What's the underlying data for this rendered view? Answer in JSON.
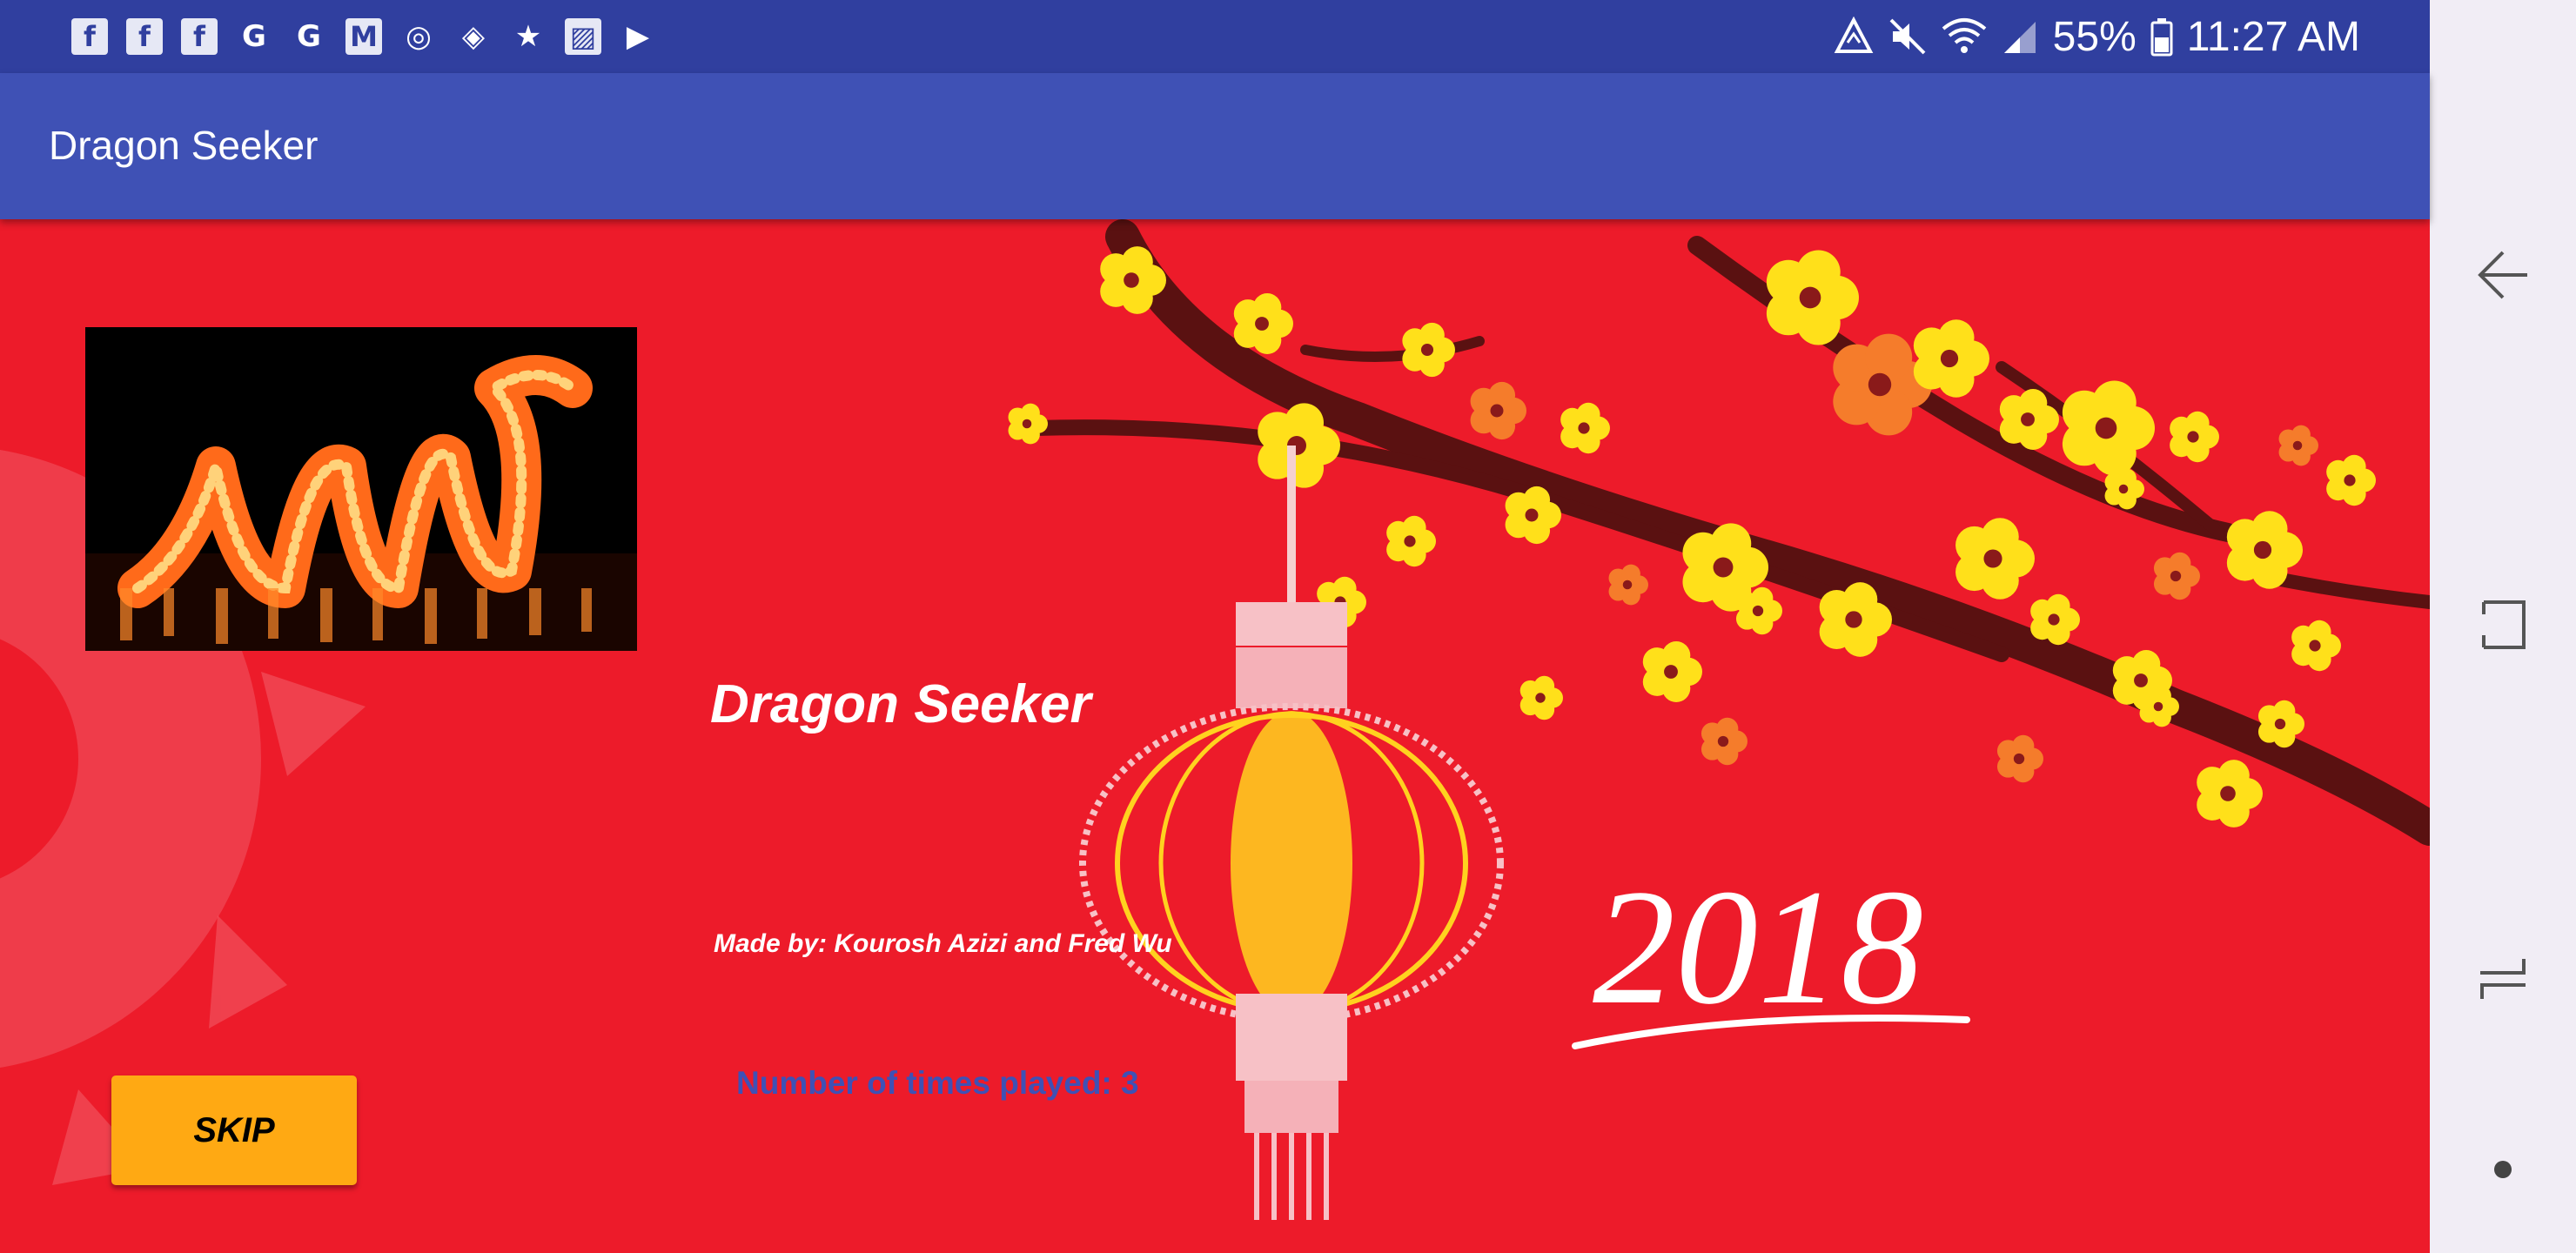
{
  "status_bar": {
    "notification_icons": [
      {
        "name": "facebook-icon",
        "glyph": "f",
        "style": "box"
      },
      {
        "name": "facebook-icon",
        "glyph": "f",
        "style": "box"
      },
      {
        "name": "facebook-icon",
        "glyph": "f",
        "style": "box"
      },
      {
        "name": "sim-card-icon",
        "glyph": "G",
        "style": "plain"
      },
      {
        "name": "google-icon",
        "glyph": "G",
        "style": "plain"
      },
      {
        "name": "gmail-icon",
        "glyph": "M",
        "style": "box"
      },
      {
        "name": "chrome-icon",
        "glyph": "◎",
        "style": "plain"
      },
      {
        "name": "maps-icon",
        "glyph": "◈",
        "style": "plain"
      },
      {
        "name": "star-icon",
        "glyph": "★",
        "style": "plain"
      },
      {
        "name": "gallery-icon",
        "glyph": "▨",
        "style": "box"
      },
      {
        "name": "play-store-icon",
        "glyph": "▶",
        "style": "plain"
      }
    ],
    "battery": "55%",
    "time": "11:27 AM"
  },
  "app_bar": {
    "title": "Dragon Seeker"
  },
  "main": {
    "headline": "Dragon Seeker",
    "credits": "Made by: Kourosh Azizi and Fred Wu",
    "played": "Number of times played: 3",
    "skip_label": "SKIP",
    "year_art": "2018"
  },
  "colors": {
    "status_bar": "#303f9f",
    "app_bar": "#3f51b5",
    "background_red": "#ed1b2a",
    "skip_button": "#ffa913",
    "played_text": "#3f51b5",
    "nav_bar": "#f1edf5"
  },
  "nav_bar": {
    "buttons": [
      {
        "name": "back-icon"
      },
      {
        "name": "recents-icon"
      },
      {
        "name": "split-screen-icon"
      },
      {
        "name": "home-dot-icon"
      }
    ]
  }
}
